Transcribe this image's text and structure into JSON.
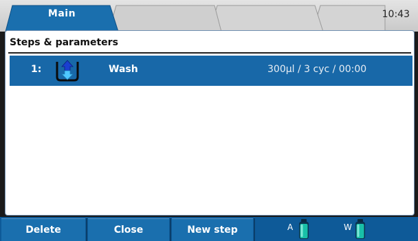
{
  "tabs": [
    {
      "label": "Main",
      "active": true
    },
    {
      "label": "",
      "active": false
    },
    {
      "label": "",
      "active": false
    }
  ],
  "clock": "10:43",
  "section_title": "Steps & parameters",
  "steps": [
    {
      "number": "1:",
      "icon": "wash-arrows-icon",
      "name": "Wash",
      "params": "300µl / 3 cyc / 00:00",
      "selected": true
    }
  ],
  "buttons": {
    "delete": "Delete",
    "close": "Close",
    "new_step": "New step"
  },
  "bottles": [
    {
      "label": "A",
      "icon": "bottle-icon"
    },
    {
      "label": "W",
      "icon": "bottle-icon"
    }
  ],
  "colors": {
    "accent": "#1868a8",
    "bottom_bar": "#1a6fae",
    "active_tab": "#1a6fae",
    "bottle_liquid": "#19c0a8"
  }
}
